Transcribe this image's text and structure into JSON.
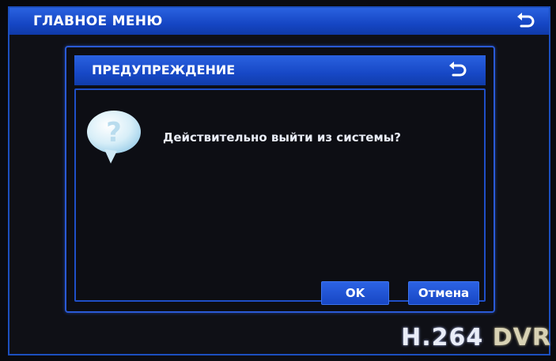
{
  "main_window": {
    "title": "ГЛАВНОЕ МЕНЮ",
    "back_icon": "back-arrow-icon"
  },
  "dialog": {
    "title": "ПРЕДУПРЕЖДЕНИЕ",
    "back_icon": "back-arrow-icon",
    "icon": "question-bubble-icon",
    "message": "Действительно выйти из системы?",
    "buttons": {
      "ok": "OK",
      "cancel": "Отмена"
    }
  },
  "brand": {
    "codec": "H.264",
    "product": "DVR"
  },
  "colors": {
    "titlebar": "#1a4fd0",
    "border": "#2a5ad6",
    "background": "#0d0e14",
    "text": "#ffffff"
  }
}
